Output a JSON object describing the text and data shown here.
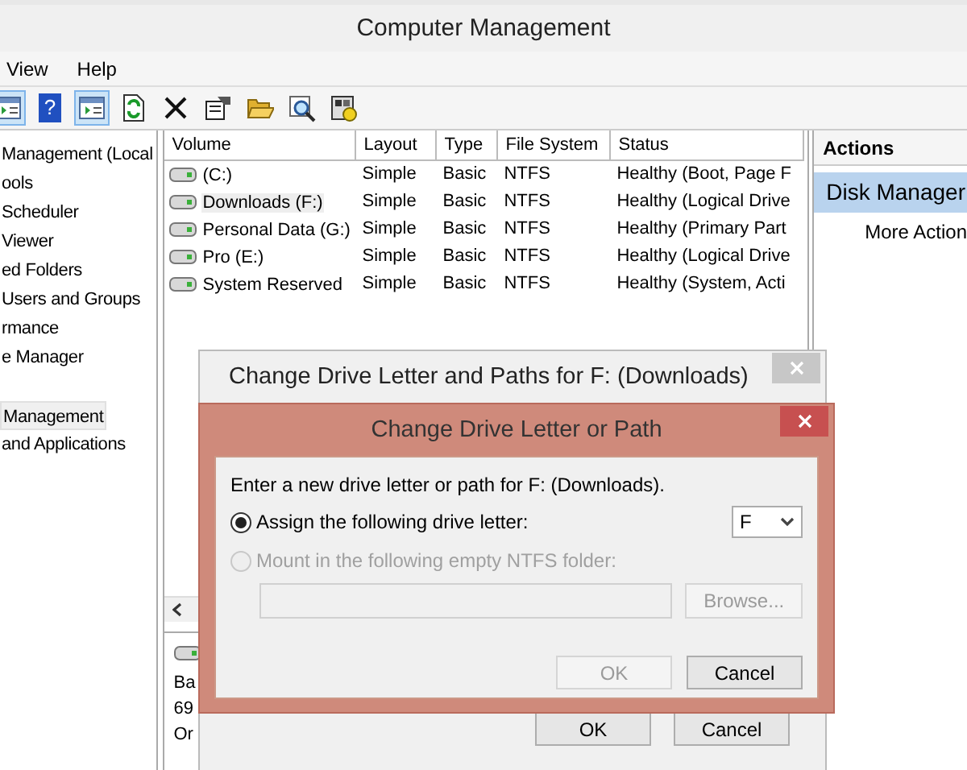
{
  "window": {
    "title": "Computer Management"
  },
  "menu": [
    {
      "label": "View"
    },
    {
      "label": "Help"
    }
  ],
  "toolbar": [
    {
      "kind": "pane",
      "pressed": true
    },
    {
      "kind": "help",
      "pressed": false,
      "glyph": "?"
    },
    {
      "kind": "pane",
      "pressed": true
    },
    {
      "kind": "refresh",
      "pressed": false
    },
    {
      "kind": "delete",
      "pressed": false
    },
    {
      "kind": "properties",
      "pressed": false
    },
    {
      "kind": "folder",
      "pressed": false
    },
    {
      "kind": "find",
      "pressed": false
    },
    {
      "kind": "settings",
      "pressed": false
    }
  ],
  "tree": [
    {
      "label": "Management (Local",
      "selected": false
    },
    {
      "label": "ools",
      "selected": false
    },
    {
      "label": "Scheduler",
      "selected": false
    },
    {
      "label": "Viewer",
      "selected": false
    },
    {
      "label": "ed Folders",
      "selected": false
    },
    {
      "label": "Users and Groups",
      "selected": false
    },
    {
      "label": "rmance",
      "selected": false
    },
    {
      "label": "e Manager",
      "selected": false
    },
    {
      "label": "Management",
      "selected": true
    },
    {
      "label": "and Applications",
      "selected": false
    }
  ],
  "table": {
    "columns": [
      "Volume",
      "Layout",
      "Type",
      "File System",
      "Status"
    ],
    "rows": [
      {
        "cells": [
          "(C:)",
          "Simple",
          "Basic",
          "NTFS",
          "Healthy (Boot, Page F"
        ],
        "selected": false
      },
      {
        "cells": [
          "Downloads (F:)",
          "Simple",
          "Basic",
          "NTFS",
          "Healthy (Logical Drive"
        ],
        "selected": true
      },
      {
        "cells": [
          "Personal Data (G:)",
          "Simple",
          "Basic",
          "NTFS",
          "Healthy (Primary Part"
        ],
        "selected": false
      },
      {
        "cells": [
          "Pro (E:)",
          "Simple",
          "Basic",
          "NTFS",
          "Healthy (Logical Drive"
        ],
        "selected": false
      },
      {
        "cells": [
          "System Reserved",
          "Simple",
          "Basic",
          "NTFS",
          "Healthy (System, Acti"
        ],
        "selected": false
      }
    ]
  },
  "disk_info": [
    "Ba",
    "69",
    "Or"
  ],
  "actions": {
    "header": "Actions",
    "items": [
      {
        "label": "Disk Manager",
        "selected": true
      },
      {
        "label": "More Action",
        "selected": false
      }
    ]
  },
  "back_dialog": {
    "title": "Change Drive Letter and Paths for F: (Downloads)",
    "buttons": [
      {
        "label": "OK"
      },
      {
        "label": "Cancel"
      }
    ]
  },
  "dialog": {
    "title": "Change Drive Letter or Path",
    "prompt": "Enter a new drive letter or path for F: (Downloads).",
    "options": [
      {
        "label": "Assign the following drive letter:",
        "selected": true,
        "disabled": false
      },
      {
        "label": "Mount in the following empty NTFS folder:",
        "selected": false,
        "disabled": true
      }
    ],
    "drive_letter": {
      "value": "F"
    },
    "folder_field": {
      "disabled": true
    },
    "browse": {
      "label": "Browse...",
      "disabled": true
    },
    "buttons": [
      {
        "label": "OK",
        "disabled": true
      },
      {
        "label": "Cancel",
        "disabled": false
      }
    ]
  }
}
